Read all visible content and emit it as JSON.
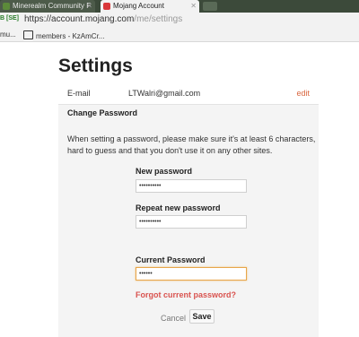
{
  "browser": {
    "tabs": [
      {
        "title": "Minerealm Community F",
        "favicon_color": "#5c8a3a"
      },
      {
        "title": "Mojang Account",
        "favicon_color": "#d9383a"
      }
    ],
    "ssl_label": "B [SE]",
    "url_host": "https://account.mojang.com",
    "url_path": "/me/settings",
    "bookmarks": [
      "mu...",
      "members - KzAmCr..."
    ]
  },
  "page": {
    "title": "Settings",
    "email": {
      "label": "E-mail",
      "value": "LTWalri@gmail.com",
      "edit_label": "edit"
    },
    "change_password": {
      "heading": "Change Password",
      "hint": "When setting a password, please make sure it's at least 6 characters, hard to guess and that you don't use it on any other sites.",
      "new_password": {
        "label": "New password",
        "value": "••••••••••"
      },
      "repeat_password": {
        "label": "Repeat new password",
        "value": "••••••••••"
      },
      "current_password": {
        "label": "Current Password",
        "value": "••••••"
      },
      "forgot_label": "Forgot current password?",
      "cancel_label": "Cancel",
      "save_label": "Save"
    }
  },
  "colors": {
    "accent": "#d9663f",
    "forgot": "#d9534f",
    "focus_border": "#e8a64a"
  }
}
